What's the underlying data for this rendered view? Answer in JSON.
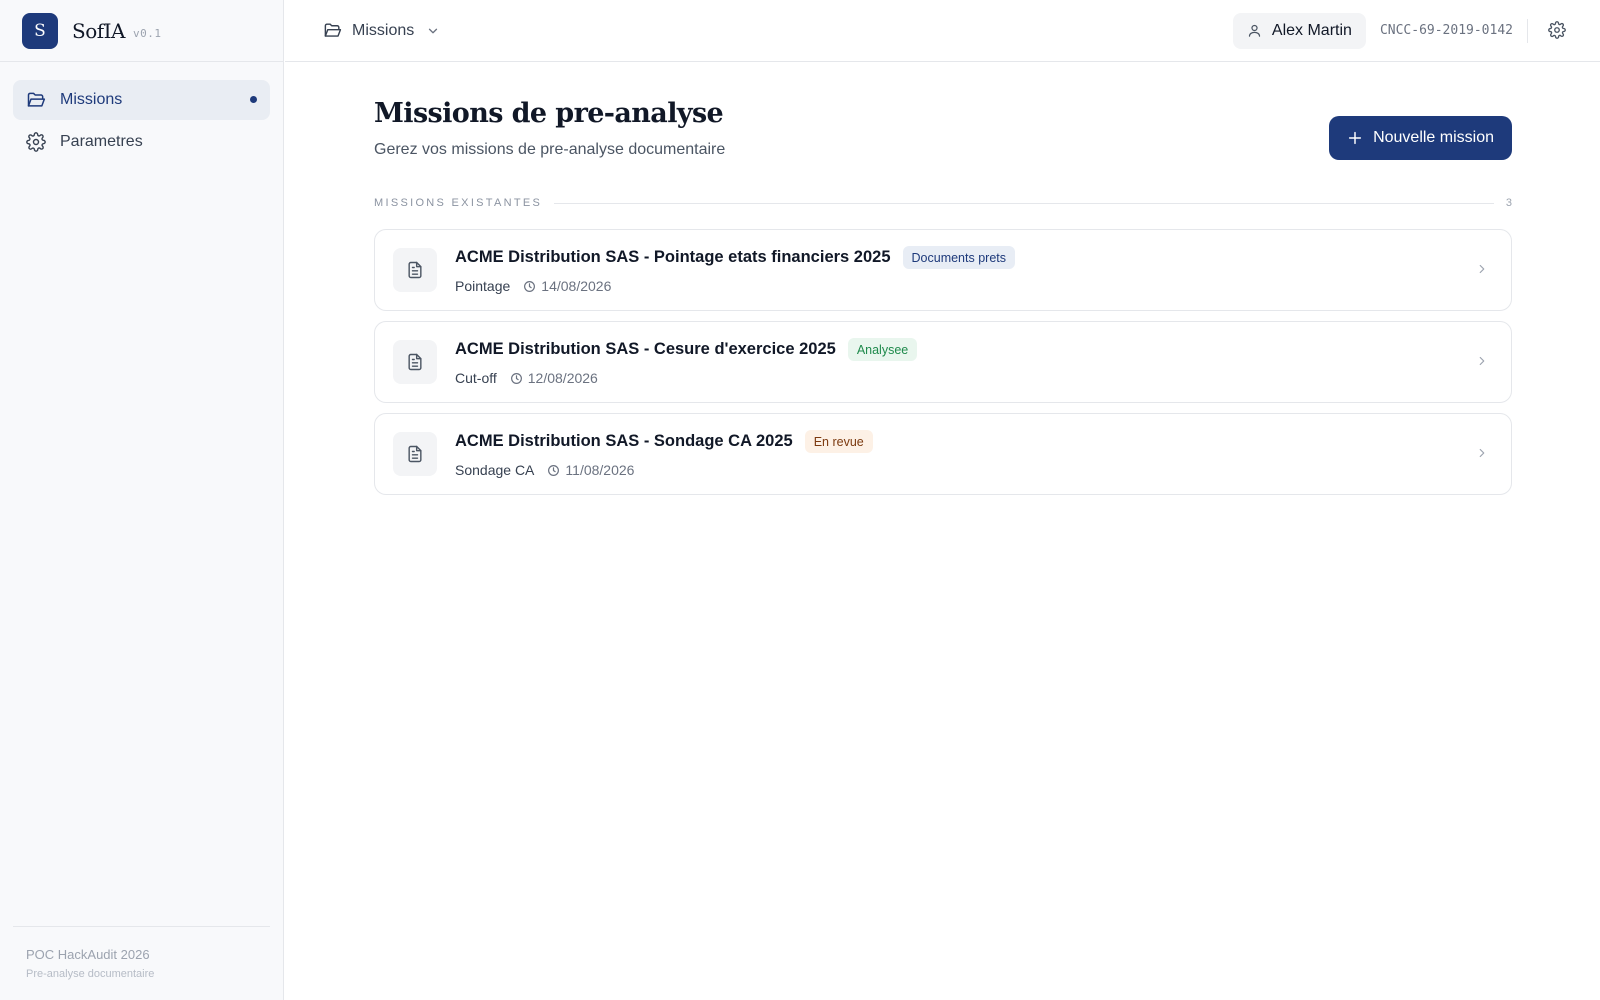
{
  "app": {
    "logo_letter": "S",
    "name": "SofIA",
    "version": "v0.1"
  },
  "sidebar": {
    "items": [
      {
        "label": "Missions",
        "icon": "folder-open-icon",
        "active": true
      },
      {
        "label": "Parametres",
        "icon": "gear-icon",
        "active": false
      }
    ],
    "footer": {
      "line1": "POC HackAudit 2026",
      "line2": "Pre-analyse documentaire"
    }
  },
  "topbar": {
    "breadcrumb": "Missions",
    "user_name": "Alex Martin",
    "cncc_id": "CNCC-69-2019-0142"
  },
  "main": {
    "title": "Missions de pre-analyse",
    "subtitle": "Gerez vos missions de pre-analyse documentaire",
    "new_button_label": "Nouvelle mission",
    "section_label": "MISSIONS EXISTANTES",
    "section_count": "3",
    "missions": [
      {
        "title": "ACME Distribution SAS - Pointage etats financiers 2025",
        "status": "Documents prets",
        "type": "Pointage",
        "date": "14/08/2026"
      },
      {
        "title": "ACME Distribution SAS - Cesure d'exercice 2025",
        "status": "Analysee",
        "type": "Cut-off",
        "date": "12/08/2026"
      },
      {
        "title": "ACME Distribution SAS - Sondage CA 2025",
        "status": "En revue",
        "type": "Sondage CA",
        "date": "11/08/2026"
      }
    ]
  },
  "colors": {
    "accent": "#1e3a7b",
    "badge_documents_bg": "#e8edf5",
    "badge_documents_fg": "#1e3a7b",
    "badge_analysee_bg": "#e9f6ee",
    "badge_analysee_fg": "#1f8a4c",
    "badge_revue_bg": "#fdf1e6",
    "badge_revue_fg": "#7c3a10"
  }
}
